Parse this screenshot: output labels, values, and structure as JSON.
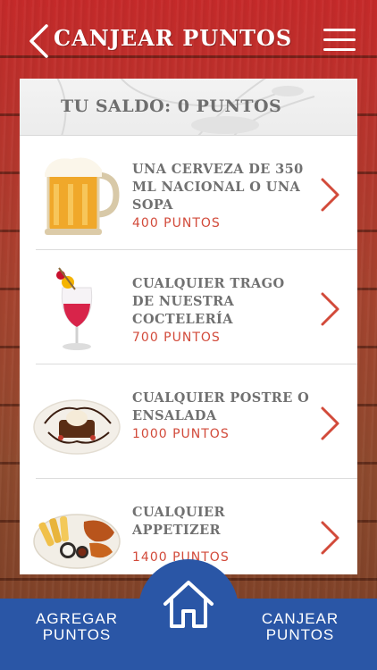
{
  "header": {
    "title": "CANJEAR PUNTOS",
    "back_icon": "chevron-left-icon",
    "menu_icon": "hamburger-menu-icon"
  },
  "balance": {
    "text": "TU SALDO: 0 PUNTOS"
  },
  "rewards": [
    {
      "name": "UNA CERVEZA DE 350 ML NACIONAL O UNA SOPA",
      "points": "400 PUNTOS",
      "icon": "beer-mug-image"
    },
    {
      "name": "CUALQUIER TRAGO DE NUESTRA COCTELERÍA",
      "points": "700 PUNTOS",
      "icon": "cocktail-image"
    },
    {
      "name": "CUALQUIER POSTRE O ENSALADA",
      "points": "1000 PUNTOS",
      "icon": "dessert-image"
    },
    {
      "name": "CUALQUIER APPETIZER",
      "points": "1400 PUNTOS",
      "icon": "appetizer-platter-image"
    }
  ],
  "bottom_nav": {
    "left_label": "AGREGAR PUNTOS",
    "right_label": "CANJEAR PUNTOS",
    "home_icon": "home-icon"
  },
  "colors": {
    "accent_red": "#d24a3a",
    "nav_blue": "#2a56a6",
    "card_white": "#ffffff",
    "text_gray": "#707070"
  }
}
